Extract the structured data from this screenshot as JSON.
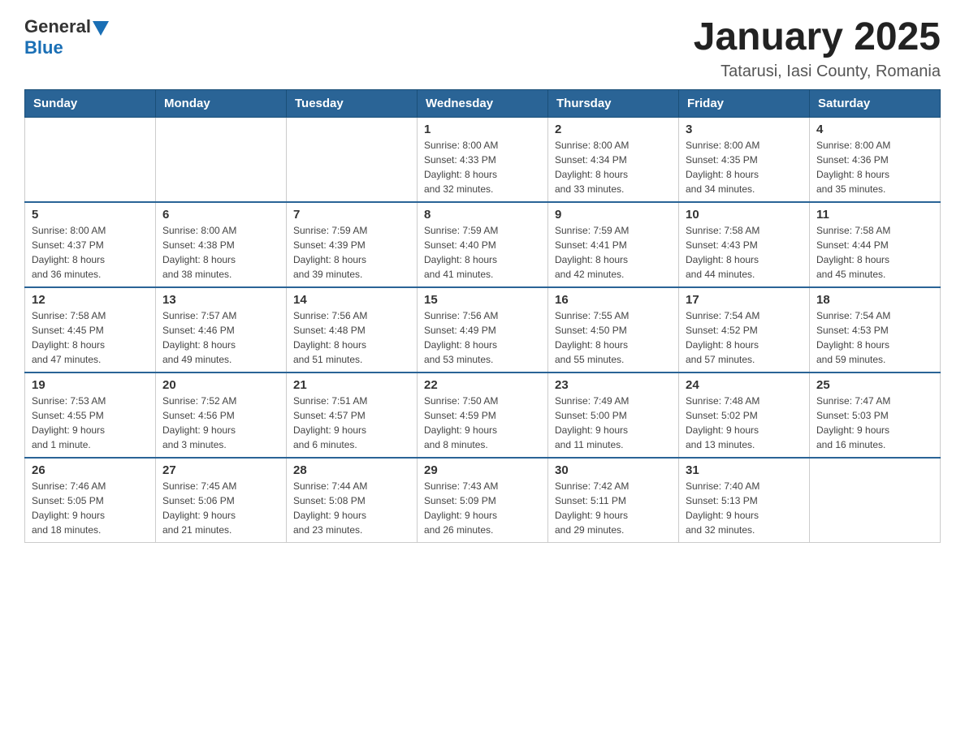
{
  "header": {
    "logo": {
      "general": "General",
      "blue": "Blue"
    },
    "title": "January 2025",
    "location": "Tatarusi, Iasi County, Romania"
  },
  "calendar": {
    "days_of_week": [
      "Sunday",
      "Monday",
      "Tuesday",
      "Wednesday",
      "Thursday",
      "Friday",
      "Saturday"
    ],
    "weeks": [
      [
        {
          "day": "",
          "info": ""
        },
        {
          "day": "",
          "info": ""
        },
        {
          "day": "",
          "info": ""
        },
        {
          "day": "1",
          "info": "Sunrise: 8:00 AM\nSunset: 4:33 PM\nDaylight: 8 hours\nand 32 minutes."
        },
        {
          "day": "2",
          "info": "Sunrise: 8:00 AM\nSunset: 4:34 PM\nDaylight: 8 hours\nand 33 minutes."
        },
        {
          "day": "3",
          "info": "Sunrise: 8:00 AM\nSunset: 4:35 PM\nDaylight: 8 hours\nand 34 minutes."
        },
        {
          "day": "4",
          "info": "Sunrise: 8:00 AM\nSunset: 4:36 PM\nDaylight: 8 hours\nand 35 minutes."
        }
      ],
      [
        {
          "day": "5",
          "info": "Sunrise: 8:00 AM\nSunset: 4:37 PM\nDaylight: 8 hours\nand 36 minutes."
        },
        {
          "day": "6",
          "info": "Sunrise: 8:00 AM\nSunset: 4:38 PM\nDaylight: 8 hours\nand 38 minutes."
        },
        {
          "day": "7",
          "info": "Sunrise: 7:59 AM\nSunset: 4:39 PM\nDaylight: 8 hours\nand 39 minutes."
        },
        {
          "day": "8",
          "info": "Sunrise: 7:59 AM\nSunset: 4:40 PM\nDaylight: 8 hours\nand 41 minutes."
        },
        {
          "day": "9",
          "info": "Sunrise: 7:59 AM\nSunset: 4:41 PM\nDaylight: 8 hours\nand 42 minutes."
        },
        {
          "day": "10",
          "info": "Sunrise: 7:58 AM\nSunset: 4:43 PM\nDaylight: 8 hours\nand 44 minutes."
        },
        {
          "day": "11",
          "info": "Sunrise: 7:58 AM\nSunset: 4:44 PM\nDaylight: 8 hours\nand 45 minutes."
        }
      ],
      [
        {
          "day": "12",
          "info": "Sunrise: 7:58 AM\nSunset: 4:45 PM\nDaylight: 8 hours\nand 47 minutes."
        },
        {
          "day": "13",
          "info": "Sunrise: 7:57 AM\nSunset: 4:46 PM\nDaylight: 8 hours\nand 49 minutes."
        },
        {
          "day": "14",
          "info": "Sunrise: 7:56 AM\nSunset: 4:48 PM\nDaylight: 8 hours\nand 51 minutes."
        },
        {
          "day": "15",
          "info": "Sunrise: 7:56 AM\nSunset: 4:49 PM\nDaylight: 8 hours\nand 53 minutes."
        },
        {
          "day": "16",
          "info": "Sunrise: 7:55 AM\nSunset: 4:50 PM\nDaylight: 8 hours\nand 55 minutes."
        },
        {
          "day": "17",
          "info": "Sunrise: 7:54 AM\nSunset: 4:52 PM\nDaylight: 8 hours\nand 57 minutes."
        },
        {
          "day": "18",
          "info": "Sunrise: 7:54 AM\nSunset: 4:53 PM\nDaylight: 8 hours\nand 59 minutes."
        }
      ],
      [
        {
          "day": "19",
          "info": "Sunrise: 7:53 AM\nSunset: 4:55 PM\nDaylight: 9 hours\nand 1 minute."
        },
        {
          "day": "20",
          "info": "Sunrise: 7:52 AM\nSunset: 4:56 PM\nDaylight: 9 hours\nand 3 minutes."
        },
        {
          "day": "21",
          "info": "Sunrise: 7:51 AM\nSunset: 4:57 PM\nDaylight: 9 hours\nand 6 minutes."
        },
        {
          "day": "22",
          "info": "Sunrise: 7:50 AM\nSunset: 4:59 PM\nDaylight: 9 hours\nand 8 minutes."
        },
        {
          "day": "23",
          "info": "Sunrise: 7:49 AM\nSunset: 5:00 PM\nDaylight: 9 hours\nand 11 minutes."
        },
        {
          "day": "24",
          "info": "Sunrise: 7:48 AM\nSunset: 5:02 PM\nDaylight: 9 hours\nand 13 minutes."
        },
        {
          "day": "25",
          "info": "Sunrise: 7:47 AM\nSunset: 5:03 PM\nDaylight: 9 hours\nand 16 minutes."
        }
      ],
      [
        {
          "day": "26",
          "info": "Sunrise: 7:46 AM\nSunset: 5:05 PM\nDaylight: 9 hours\nand 18 minutes."
        },
        {
          "day": "27",
          "info": "Sunrise: 7:45 AM\nSunset: 5:06 PM\nDaylight: 9 hours\nand 21 minutes."
        },
        {
          "day": "28",
          "info": "Sunrise: 7:44 AM\nSunset: 5:08 PM\nDaylight: 9 hours\nand 23 minutes."
        },
        {
          "day": "29",
          "info": "Sunrise: 7:43 AM\nSunset: 5:09 PM\nDaylight: 9 hours\nand 26 minutes."
        },
        {
          "day": "30",
          "info": "Sunrise: 7:42 AM\nSunset: 5:11 PM\nDaylight: 9 hours\nand 29 minutes."
        },
        {
          "day": "31",
          "info": "Sunrise: 7:40 AM\nSunset: 5:13 PM\nDaylight: 9 hours\nand 32 minutes."
        },
        {
          "day": "",
          "info": ""
        }
      ]
    ]
  }
}
